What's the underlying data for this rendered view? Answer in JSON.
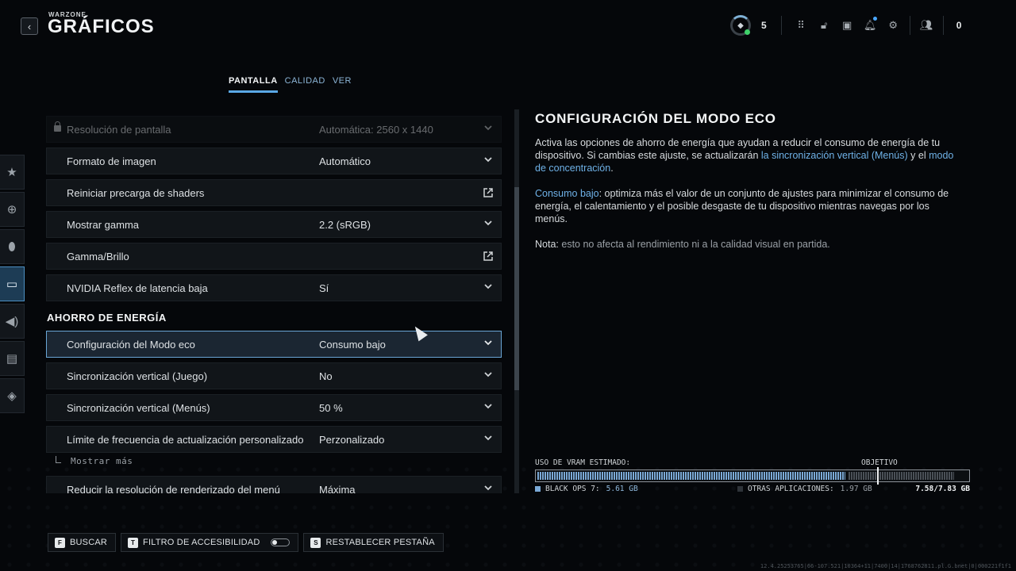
{
  "header": {
    "brand": "WARZONE",
    "title": "GRÁFICOS",
    "back_icon": "chevron-left-icon"
  },
  "topbar": {
    "level": "5",
    "level_icon": "prestige-icon",
    "icons": [
      "grid-icon",
      "lock-open-icon",
      "camera-icon",
      "bell-icon",
      "gear-icon",
      "social-icon"
    ],
    "party_count": "0"
  },
  "tabs": [
    {
      "label": "PANTALLA",
      "active": true
    },
    {
      "label": "CALIDAD",
      "active": false
    },
    {
      "label": "VER",
      "active": false
    }
  ],
  "rail": [
    {
      "icon": "star-icon",
      "glyph": "★",
      "active": false
    },
    {
      "icon": "gamepad-icon",
      "glyph": "🎮",
      "active": false
    },
    {
      "icon": "mouse-icon",
      "glyph": "🖱",
      "active": false
    },
    {
      "icon": "display-icon",
      "glyph": "▭",
      "active": true
    },
    {
      "icon": "speaker-icon",
      "glyph": "🔊",
      "active": false
    },
    {
      "icon": "interface-icon",
      "glyph": "▤",
      "active": false
    },
    {
      "icon": "network-icon",
      "glyph": "◈",
      "active": false
    }
  ],
  "settings": {
    "rows": [
      {
        "label": "Resolución de pantalla",
        "value": "Automática: 2560 x 1440",
        "control": "dropdown",
        "locked": true
      },
      {
        "label": "Formato de imagen",
        "value": "Automático",
        "control": "dropdown"
      },
      {
        "label": "Reiniciar precarga de shaders",
        "value": "",
        "control": "external"
      },
      {
        "label": "Mostrar gamma",
        "value": "2.2 (sRGB)",
        "control": "dropdown"
      },
      {
        "label": "Gamma/Brillo",
        "value": "",
        "control": "external"
      },
      {
        "label": "NVIDIA Reflex de latencia baja",
        "value": "Sí",
        "control": "dropdown"
      }
    ],
    "section_title": "AHORRO DE ENERGÍA",
    "energy_rows": [
      {
        "label": "Configuración del Modo eco",
        "value": "Consumo bajo",
        "control": "dropdown",
        "selected": true
      },
      {
        "label": "Sincronización vertical (Juego)",
        "value": "No",
        "control": "dropdown"
      },
      {
        "label": "Sincronización vertical (Menús)",
        "value": "50 %",
        "control": "dropdown"
      },
      {
        "label": "Límite de frecuencia de actualización personalizado",
        "value": "Perzonalizado",
        "control": "dropdown"
      }
    ],
    "show_more": "Mostrar más",
    "last_row": {
      "label": "Reducir la resolución de renderizado del menú",
      "value": "Máxima",
      "control": "dropdown"
    }
  },
  "description": {
    "title": "CONFIGURACIÓN DEL MODO ECO",
    "p1_a": "Activa las opciones de ahorro de energía que ayudan a reducir el consumo de energía de tu dispositivo. Si cambias este ajuste, se actualizarán ",
    "p1_link1": "la sincronización vertical (Menús)",
    "p1_b": " y el ",
    "p1_link2": "modo de concentración",
    "p1_c": ".",
    "p2_link": "Consumo bajo",
    "p2_text": ": optimiza más el valor de un conjunto de ajustes para minimizar el consumo de energía, el calentamiento y el posible desgaste de tu dispositivo mientras navegas por los menús.",
    "p3_label": "Nota:",
    "p3_text": " esto no afecta al rendimiento ni a la calidad visual en partida."
  },
  "vram": {
    "label": "USO DE VRAM ESTIMADO:",
    "target_label": "OBJETIVO",
    "game_label": "BLACK OPS 7:",
    "game_value": "5.61 GB",
    "game_gb": 5.61,
    "other_label": "OTRAS APLICACIONES:",
    "other_value": "1.97 GB",
    "other_gb": 1.97,
    "total": "7.58/7.83 GB",
    "capacity_gb": 7.83,
    "colors": {
      "game": "#7aa9d6",
      "other": "#4a5057"
    }
  },
  "footer": {
    "buttons": [
      {
        "key": "F",
        "label": "BUSCAR"
      },
      {
        "key": "T",
        "label": "FILTRO DE ACCESIBILIDAD",
        "toggle": true
      },
      {
        "key": "S",
        "label": "RESTABLECER PESTAÑA"
      }
    ],
    "build": "12.4.25253765|66-107.521|10364+11|7400|14|1768762811.pl.G.bnet|0|000221f1f1"
  },
  "colors": {
    "accent": "#5aa8e6",
    "link": "#6fb2e8",
    "selected_border": "#6aa6d6",
    "online": "#3fd16a"
  }
}
